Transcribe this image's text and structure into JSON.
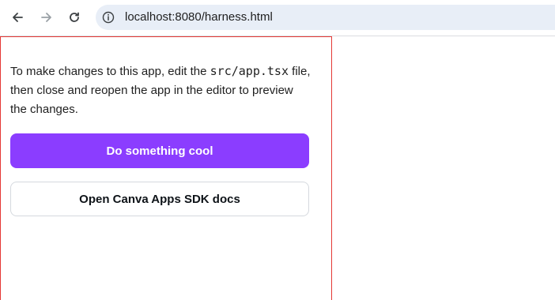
{
  "browser": {
    "url": "localhost:8080/harness.html",
    "icons": {
      "back": "arrow-left-icon",
      "forward": "arrow-right-icon",
      "reload": "reload-icon",
      "info": "info-circle-icon"
    },
    "colors": {
      "address_bg": "#e8eef7"
    }
  },
  "app": {
    "intro": {
      "before_code": "To make changes to this app, edit the ",
      "code": "src/app.tsx",
      "after_code": " file, then close and reopen the app in the editor to preview the changes."
    },
    "primary_button_label": "Do something cool",
    "secondary_button_label": "Open Canva Apps SDK docs",
    "colors": {
      "primary": "#8b3dff",
      "panel_border": "#e53935"
    }
  }
}
